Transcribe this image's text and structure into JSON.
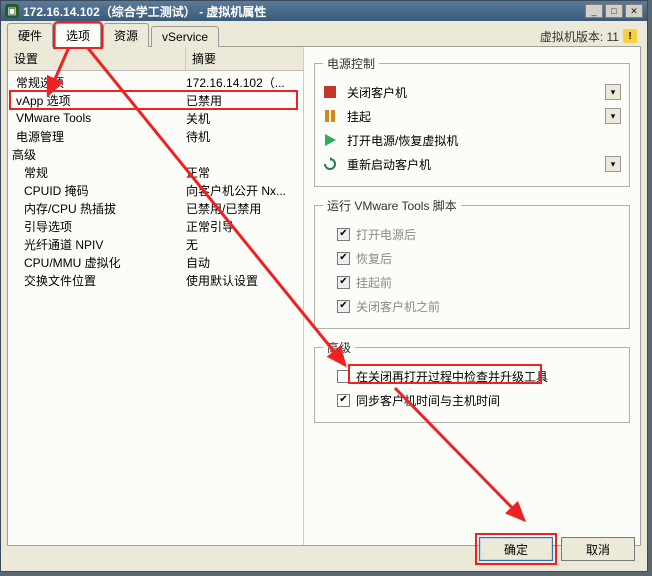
{
  "title": "172.16.14.102（综合学工测试） - 虚拟机属性",
  "version_label": "虚拟机版本: 11",
  "tabs": {
    "t0": "硬件",
    "t1": "选项",
    "t2": "资源",
    "t3": "vService"
  },
  "columns": {
    "c1": "设置",
    "c2": "摘要"
  },
  "rows": [
    {
      "label": "常规选项",
      "summary": "172.16.14.102（..."
    },
    {
      "label": "vApp 选项",
      "summary": "已禁用"
    },
    {
      "label": "VMware Tools",
      "summary": "关机"
    },
    {
      "label": "电源管理",
      "summary": "待机"
    },
    {
      "label": "高级",
      "summary": ""
    },
    {
      "label": "常规",
      "summary": "正常"
    },
    {
      "label": "CPUID 掩码",
      "summary": "向客户机公开 Nx..."
    },
    {
      "label": "内存/CPU 热插拔",
      "summary": "已禁用/已禁用"
    },
    {
      "label": "引导选项",
      "summary": "正常引导"
    },
    {
      "label": "光纤通道 NPIV",
      "summary": "无"
    },
    {
      "label": "CPU/MMU 虚拟化",
      "summary": "自动"
    },
    {
      "label": "交换文件位置",
      "summary": "使用默认设置"
    }
  ],
  "power": {
    "legend": "电源控制",
    "items": [
      {
        "icon": "stop",
        "label": "关闭客户机"
      },
      {
        "icon": "pause",
        "label": "挂起"
      },
      {
        "icon": "play",
        "label": "打开电源/恢复虚拟机"
      },
      {
        "icon": "restart",
        "label": "重新启动客户机"
      }
    ]
  },
  "scripts": {
    "legend": "运行 VMware Tools 脚本",
    "items": [
      {
        "label": "打开电源后",
        "checked": true,
        "disabled": true
      },
      {
        "label": "恢复后",
        "checked": true,
        "disabled": true
      },
      {
        "label": "挂起前",
        "checked": true,
        "disabled": true
      },
      {
        "label": "关闭客户机之前",
        "checked": true,
        "disabled": true
      }
    ]
  },
  "advanced": {
    "legend": "高级",
    "items": [
      {
        "label": "在关闭再打开过程中检查并升级工具",
        "checked": false
      },
      {
        "label": "同步客户机时间与主机时间",
        "checked": true
      }
    ]
  },
  "buttons": {
    "ok": "确定",
    "cancel": "取消"
  }
}
